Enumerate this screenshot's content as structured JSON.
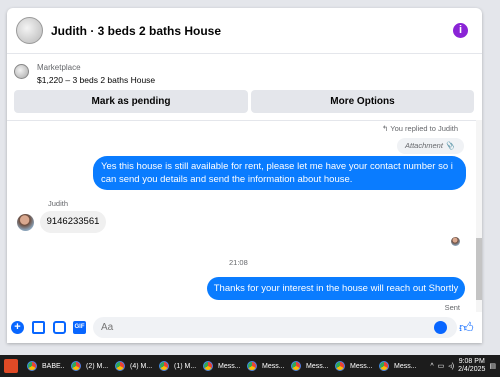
{
  "header": {
    "title": "Judith · 3 beds 2 baths House",
    "info_icon": "info-icon",
    "accent": "#8a24d6"
  },
  "listing": {
    "source": "Marketplace",
    "price_title": "$1,220 – 3 beds 2 baths House",
    "buttons": {
      "pending": "Mark as pending",
      "options": "More Options"
    }
  },
  "messages": {
    "replied_to": "You replied to Judith",
    "attachment_label": "Attachment",
    "outgoing_1": "Yes this house is still available for rent, please let me have your contact number so i can send you details and send the information about house.",
    "sender_name": "Judith",
    "incoming_1": "9146233561",
    "timestamp": "21:08",
    "outgoing_2": "Thanks for your interest in the house will reach out Shortly",
    "status": "Sent",
    "bubble_color": "#0a7cff"
  },
  "composer": {
    "placeholder": "Aa",
    "gif_label": "GIF",
    "plus_label": "+",
    "like_icon": "thumbs-up-icon"
  },
  "taskbar": {
    "items": [
      {
        "label": "BABE..."
      },
      {
        "label": "(2) M..."
      },
      {
        "label": "(4) M..."
      },
      {
        "label": "(1) M..."
      },
      {
        "label": "Mess..."
      },
      {
        "label": "Mess..."
      },
      {
        "label": "Mess..."
      },
      {
        "label": "Mess..."
      },
      {
        "label": "Mess..."
      }
    ],
    "time": "9:08 PM",
    "date": "2/4/2025"
  }
}
